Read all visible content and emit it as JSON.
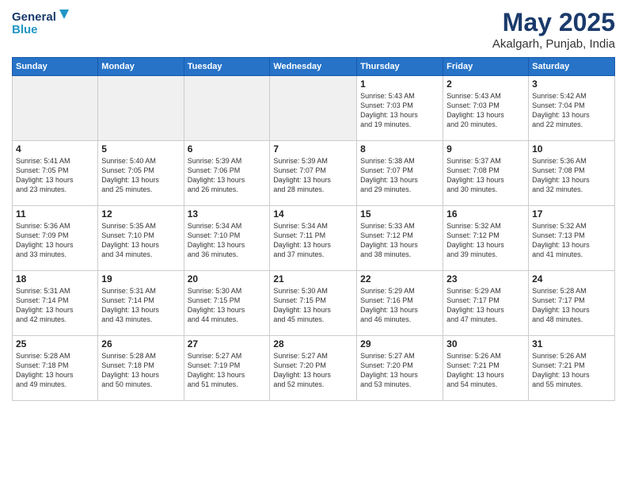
{
  "header": {
    "logo_line1": "General",
    "logo_line2": "Blue",
    "month": "May 2025",
    "location": "Akalgarh, Punjab, India"
  },
  "weekdays": [
    "Sunday",
    "Monday",
    "Tuesday",
    "Wednesday",
    "Thursday",
    "Friday",
    "Saturday"
  ],
  "weeks": [
    [
      {
        "day": "",
        "info": ""
      },
      {
        "day": "",
        "info": ""
      },
      {
        "day": "",
        "info": ""
      },
      {
        "day": "",
        "info": ""
      },
      {
        "day": "1",
        "info": "Sunrise: 5:43 AM\nSunset: 7:03 PM\nDaylight: 13 hours\nand 19 minutes."
      },
      {
        "day": "2",
        "info": "Sunrise: 5:43 AM\nSunset: 7:03 PM\nDaylight: 13 hours\nand 20 minutes."
      },
      {
        "day": "3",
        "info": "Sunrise: 5:42 AM\nSunset: 7:04 PM\nDaylight: 13 hours\nand 22 minutes."
      }
    ],
    [
      {
        "day": "4",
        "info": "Sunrise: 5:41 AM\nSunset: 7:05 PM\nDaylight: 13 hours\nand 23 minutes."
      },
      {
        "day": "5",
        "info": "Sunrise: 5:40 AM\nSunset: 7:05 PM\nDaylight: 13 hours\nand 25 minutes."
      },
      {
        "day": "6",
        "info": "Sunrise: 5:39 AM\nSunset: 7:06 PM\nDaylight: 13 hours\nand 26 minutes."
      },
      {
        "day": "7",
        "info": "Sunrise: 5:39 AM\nSunset: 7:07 PM\nDaylight: 13 hours\nand 28 minutes."
      },
      {
        "day": "8",
        "info": "Sunrise: 5:38 AM\nSunset: 7:07 PM\nDaylight: 13 hours\nand 29 minutes."
      },
      {
        "day": "9",
        "info": "Sunrise: 5:37 AM\nSunset: 7:08 PM\nDaylight: 13 hours\nand 30 minutes."
      },
      {
        "day": "10",
        "info": "Sunrise: 5:36 AM\nSunset: 7:08 PM\nDaylight: 13 hours\nand 32 minutes."
      }
    ],
    [
      {
        "day": "11",
        "info": "Sunrise: 5:36 AM\nSunset: 7:09 PM\nDaylight: 13 hours\nand 33 minutes."
      },
      {
        "day": "12",
        "info": "Sunrise: 5:35 AM\nSunset: 7:10 PM\nDaylight: 13 hours\nand 34 minutes."
      },
      {
        "day": "13",
        "info": "Sunrise: 5:34 AM\nSunset: 7:10 PM\nDaylight: 13 hours\nand 36 minutes."
      },
      {
        "day": "14",
        "info": "Sunrise: 5:34 AM\nSunset: 7:11 PM\nDaylight: 13 hours\nand 37 minutes."
      },
      {
        "day": "15",
        "info": "Sunrise: 5:33 AM\nSunset: 7:12 PM\nDaylight: 13 hours\nand 38 minutes."
      },
      {
        "day": "16",
        "info": "Sunrise: 5:32 AM\nSunset: 7:12 PM\nDaylight: 13 hours\nand 39 minutes."
      },
      {
        "day": "17",
        "info": "Sunrise: 5:32 AM\nSunset: 7:13 PM\nDaylight: 13 hours\nand 41 minutes."
      }
    ],
    [
      {
        "day": "18",
        "info": "Sunrise: 5:31 AM\nSunset: 7:14 PM\nDaylight: 13 hours\nand 42 minutes."
      },
      {
        "day": "19",
        "info": "Sunrise: 5:31 AM\nSunset: 7:14 PM\nDaylight: 13 hours\nand 43 minutes."
      },
      {
        "day": "20",
        "info": "Sunrise: 5:30 AM\nSunset: 7:15 PM\nDaylight: 13 hours\nand 44 minutes."
      },
      {
        "day": "21",
        "info": "Sunrise: 5:30 AM\nSunset: 7:15 PM\nDaylight: 13 hours\nand 45 minutes."
      },
      {
        "day": "22",
        "info": "Sunrise: 5:29 AM\nSunset: 7:16 PM\nDaylight: 13 hours\nand 46 minutes."
      },
      {
        "day": "23",
        "info": "Sunrise: 5:29 AM\nSunset: 7:17 PM\nDaylight: 13 hours\nand 47 minutes."
      },
      {
        "day": "24",
        "info": "Sunrise: 5:28 AM\nSunset: 7:17 PM\nDaylight: 13 hours\nand 48 minutes."
      }
    ],
    [
      {
        "day": "25",
        "info": "Sunrise: 5:28 AM\nSunset: 7:18 PM\nDaylight: 13 hours\nand 49 minutes."
      },
      {
        "day": "26",
        "info": "Sunrise: 5:28 AM\nSunset: 7:18 PM\nDaylight: 13 hours\nand 50 minutes."
      },
      {
        "day": "27",
        "info": "Sunrise: 5:27 AM\nSunset: 7:19 PM\nDaylight: 13 hours\nand 51 minutes."
      },
      {
        "day": "28",
        "info": "Sunrise: 5:27 AM\nSunset: 7:20 PM\nDaylight: 13 hours\nand 52 minutes."
      },
      {
        "day": "29",
        "info": "Sunrise: 5:27 AM\nSunset: 7:20 PM\nDaylight: 13 hours\nand 53 minutes."
      },
      {
        "day": "30",
        "info": "Sunrise: 5:26 AM\nSunset: 7:21 PM\nDaylight: 13 hours\nand 54 minutes."
      },
      {
        "day": "31",
        "info": "Sunrise: 5:26 AM\nSunset: 7:21 PM\nDaylight: 13 hours\nand 55 minutes."
      }
    ]
  ]
}
